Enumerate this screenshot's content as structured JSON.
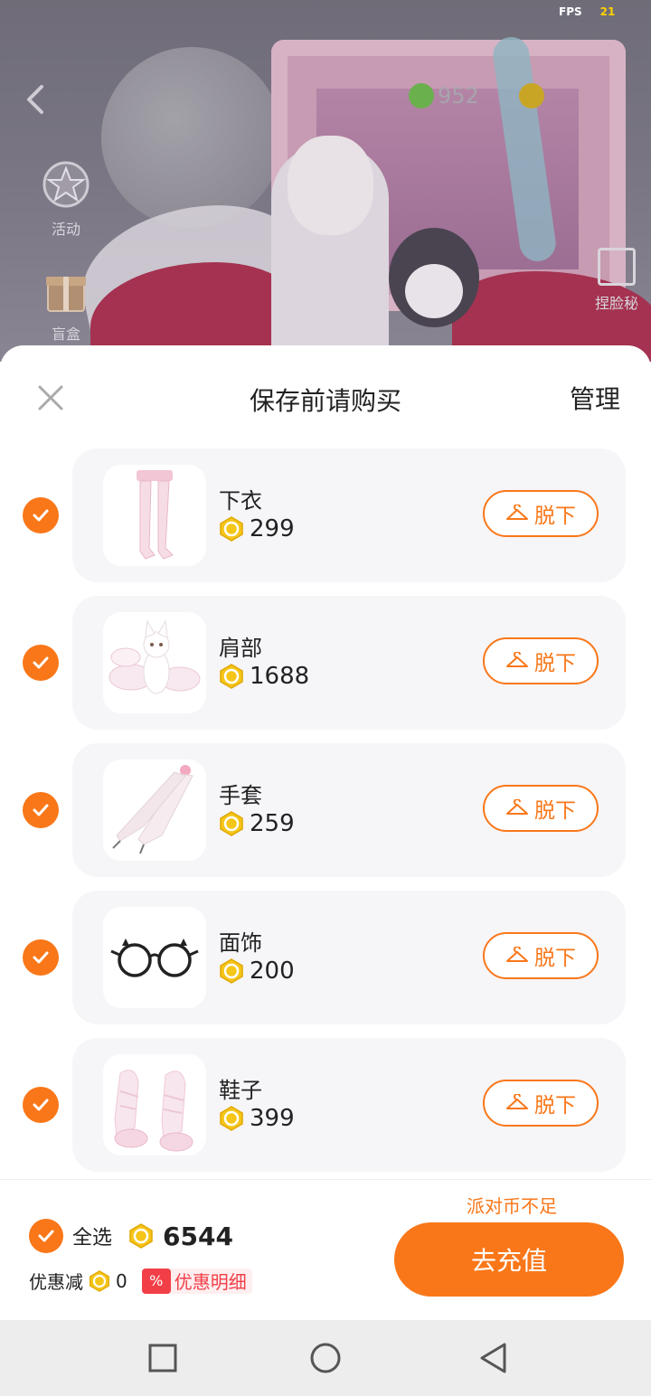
{
  "status": {
    "fps_label": "FPS",
    "fps_value": "21"
  },
  "background": {
    "coins": [
      {
        "value": "952",
        "color": "#6ab04c"
      },
      {
        "value": "",
        "color": "#e8b800"
      }
    ],
    "side_buttons": [
      {
        "label": "活动",
        "icon": "star-event-icon"
      },
      {
        "label": "盲盒",
        "icon": "gift-box-icon"
      }
    ],
    "right_button": {
      "label": "捏脸秘"
    }
  },
  "sheet": {
    "title": "保存前请购买",
    "manage_label": "管理",
    "items": [
      {
        "name": "下衣",
        "price": "299",
        "action": "脱下",
        "icon": "stockings-icon",
        "checked": true
      },
      {
        "name": "肩部",
        "price": "1688",
        "action": "脱下",
        "icon": "fox-shoulder-icon",
        "checked": true
      },
      {
        "name": "手套",
        "price": "259",
        "action": "脱下",
        "icon": "claw-glove-icon",
        "checked": true
      },
      {
        "name": "面饰",
        "price": "200",
        "action": "脱下",
        "icon": "glasses-icon",
        "checked": true
      },
      {
        "name": "鞋子",
        "price": "399",
        "action": "脱下",
        "icon": "ribbon-shoes-icon",
        "checked": true
      }
    ],
    "footer": {
      "select_all_label": "全选",
      "total": "6544",
      "discount_label": "优惠减",
      "discount_value": "0",
      "discount_tag_symbol": "%",
      "discount_detail_label": "优惠明细",
      "insufficient_text": "派对币不足",
      "recharge_label": "去充值"
    }
  },
  "colors": {
    "accent": "#f97719",
    "coin": "#f5c518",
    "discount_red": "#f23f47"
  }
}
